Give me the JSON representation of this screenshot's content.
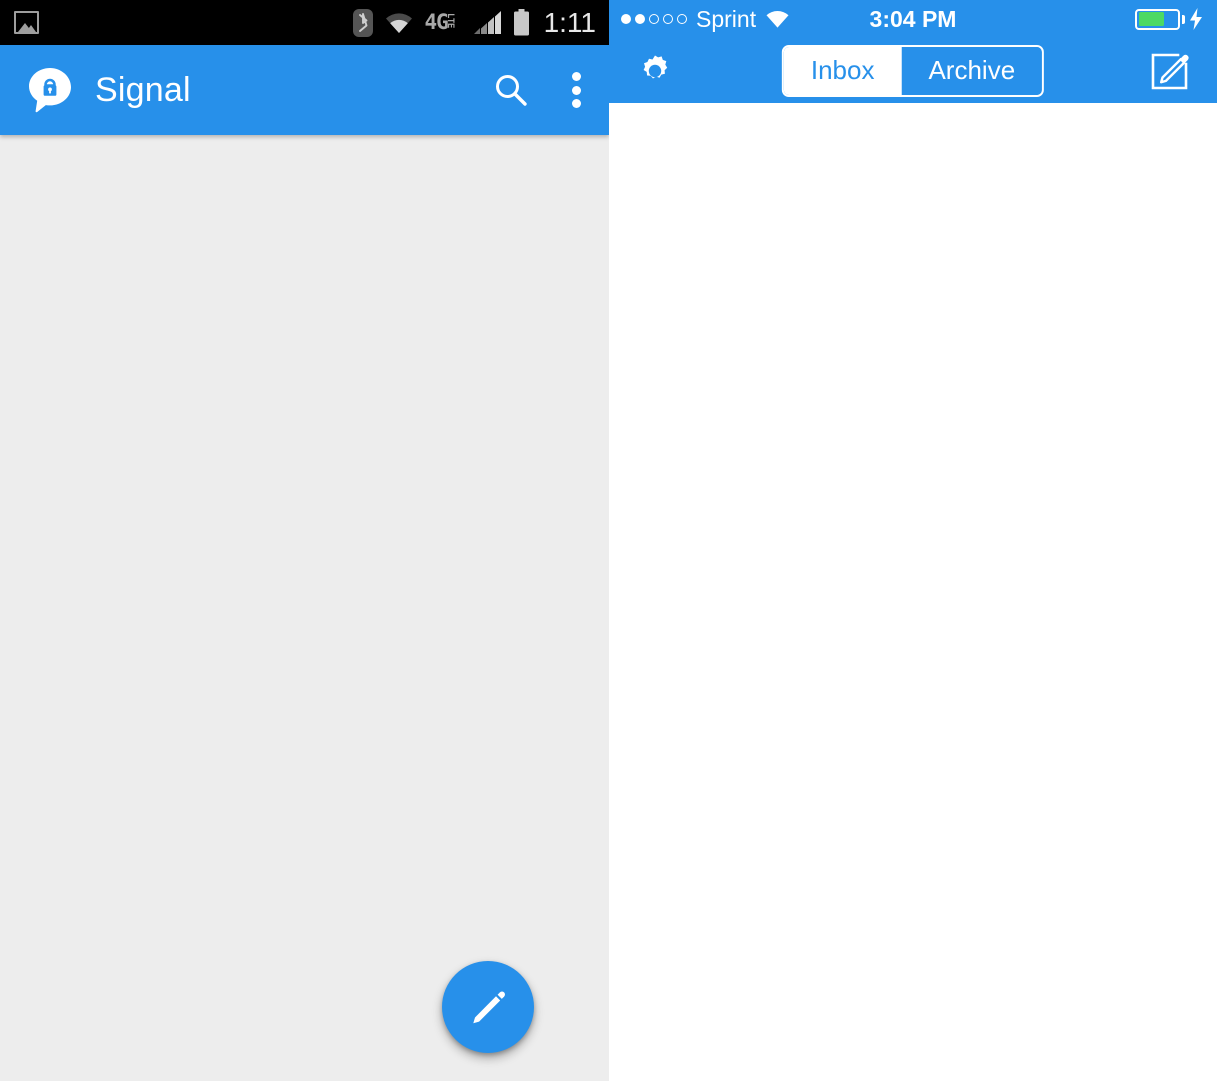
{
  "android": {
    "status_bar": {
      "clock": "1:11",
      "icons": [
        "photo-icon",
        "bluetooth-icon",
        "wifi-icon",
        "4g-lte-icon",
        "signal-bars-icon",
        "battery-icon"
      ],
      "network_label": "4G",
      "network_sub_label": "LTE",
      "background_color": "#000000",
      "icon_color": "#a8a8a8"
    },
    "app_bar": {
      "title": "Signal",
      "logo_icon": "signal-lock-bubble-logo",
      "search_icon": "search-icon",
      "overflow_icon": "overflow-menu-icon",
      "background_color": "#2790ea",
      "text_color": "#ffffff"
    },
    "content": {
      "background_color": "#ededed",
      "conversations": []
    },
    "fab": {
      "icon": "pencil-compose-icon",
      "background_color": "#2790ea",
      "icon_color": "#ffffff"
    }
  },
  "ios": {
    "status_bar": {
      "signal_dots_filled": 2,
      "signal_dots_total": 5,
      "carrier": "Sprint",
      "wifi_icon": "wifi-icon",
      "time": "3:04 PM",
      "battery_level_percent": 56,
      "battery_charging": true,
      "battery_fill_color": "#4cd964",
      "background_color": "#2790ea",
      "text_color": "#ffffff"
    },
    "nav_bar": {
      "settings_icon": "gear-icon",
      "compose_icon": "compose-square-pencil-icon",
      "segments": [
        {
          "label": "Inbox",
          "selected": false
        },
        {
          "label": "Archive",
          "selected": true
        }
      ],
      "background_color": "#2790ea"
    },
    "content": {
      "background_color": "#ffffff",
      "conversations": []
    }
  }
}
